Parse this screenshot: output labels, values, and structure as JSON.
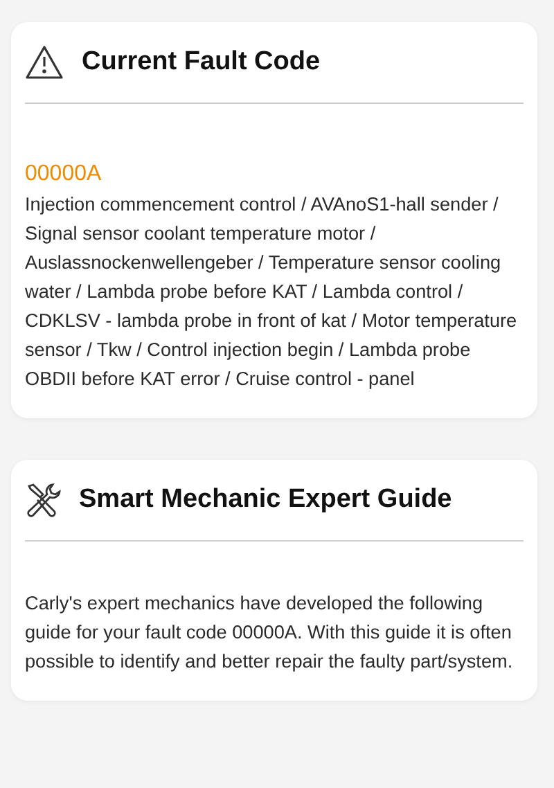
{
  "cards": [
    {
      "kind": "fault",
      "title": "Current Fault Code",
      "code": "00000A",
      "body": "Injection commencement control / AVAnoS1-hall sender / Signal sensor coolant temperature motor / Auslassnockenwellengeber / Temperature sensor cooling water / Lambda probe before KAT / Lambda control / CDKLSV - lambda probe in front of kat / Motor temperature sensor / Tkw / Control injection begin / Lambda probe OBDII before KAT error / Cruise control - panel"
    },
    {
      "kind": "guide",
      "title": "Smart Mechanic Expert Guide",
      "body": "Carly's expert mechanics have developed the following guide for your fault code 00000A. With this guide it is often possible to identify and better repair the faulty part/system."
    }
  ]
}
